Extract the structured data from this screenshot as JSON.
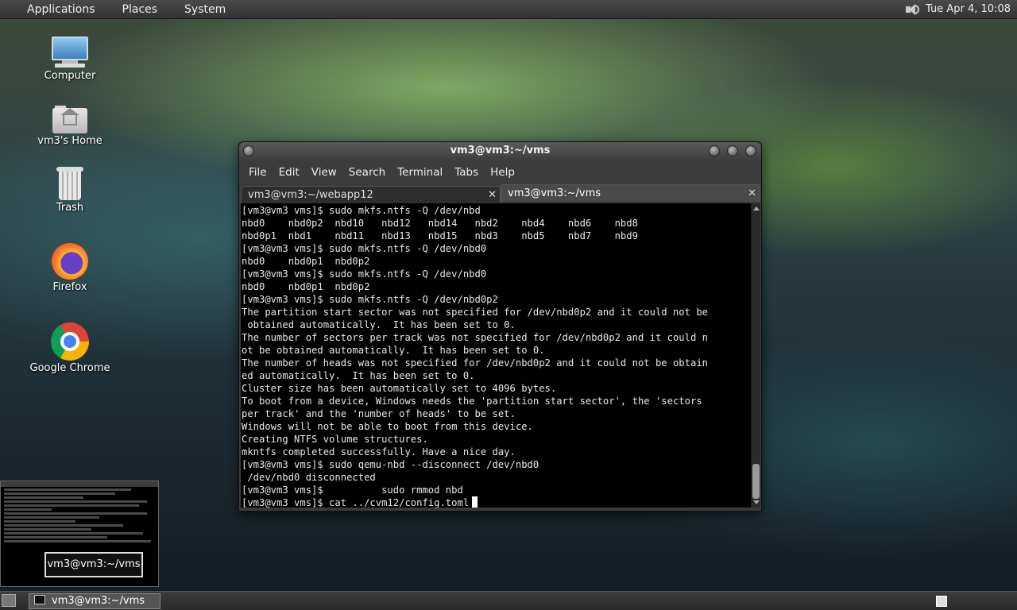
{
  "top_panel": {
    "menus": [
      "Applications",
      "Places",
      "System"
    ],
    "volume_icon": "volume-icon",
    "clock": "Tue Apr  4, 10:08"
  },
  "desktop_icons": [
    {
      "label": "Computer",
      "icon": "computer-icon"
    },
    {
      "label": "vm3's Home",
      "icon": "home-folder-icon"
    },
    {
      "label": "Trash",
      "icon": "trash-icon"
    },
    {
      "label": "Firefox",
      "icon": "firefox-icon"
    },
    {
      "label": "Google Chrome",
      "icon": "chrome-icon"
    }
  ],
  "terminal": {
    "title": "vm3@vm3:~/vms",
    "menu": [
      "File",
      "Edit",
      "View",
      "Search",
      "Terminal",
      "Tabs",
      "Help"
    ],
    "tabs": [
      {
        "label": "vm3@vm3:~/webapp12",
        "active": false
      },
      {
        "label": "vm3@vm3:~/vms",
        "active": true
      }
    ],
    "lines": [
      "[vm3@vm3 vms]$ sudo mkfs.ntfs -Q /dev/nbd",
      "nbd0    nbd0p2  nbd10   nbd12   nbd14   nbd2    nbd4    nbd6    nbd8",
      "nbd0p1  nbd1    nbd11   nbd13   nbd15   nbd3    nbd5    nbd7    nbd9",
      "[vm3@vm3 vms]$ sudo mkfs.ntfs -Q /dev/nbd0",
      "nbd0    nbd0p1  nbd0p2",
      "[vm3@vm3 vms]$ sudo mkfs.ntfs -Q /dev/nbd0",
      "nbd0    nbd0p1  nbd0p2",
      "[vm3@vm3 vms]$ sudo mkfs.ntfs -Q /dev/nbd0p2",
      "The partition start sector was not specified for /dev/nbd0p2 and it could not be",
      " obtained automatically.  It has been set to 0.",
      "The number of sectors per track was not specified for /dev/nbd0p2 and it could n",
      "ot be obtained automatically.  It has been set to 0.",
      "The number of heads was not specified for /dev/nbd0p2 and it could not be obtain",
      "ed automatically.  It has been set to 0.",
      "Cluster size has been automatically set to 4096 bytes.",
      "To boot from a device, Windows needs the 'partition start sector', the 'sectors",
      "per track' and the 'number of heads' to be set.",
      "Windows will not be able to boot from this device.",
      "Creating NTFS volume structures.",
      "mkntfs completed successfully. Have a nice day.",
      "[vm3@vm3 vms]$ sudo qemu-nbd --disconnect /dev/nbd0",
      " /dev/nbd0 disconnected",
      "[vm3@vm3 vms]$          sudo rmmod nbd",
      "[vm3@vm3 vms]$ cat ../cvm12/config.toml"
    ]
  },
  "window_preview": {
    "tooltip": "vm3@vm3:~/vms"
  },
  "bottom_panel": {
    "task_label": "vm3@vm3:~/vms"
  }
}
